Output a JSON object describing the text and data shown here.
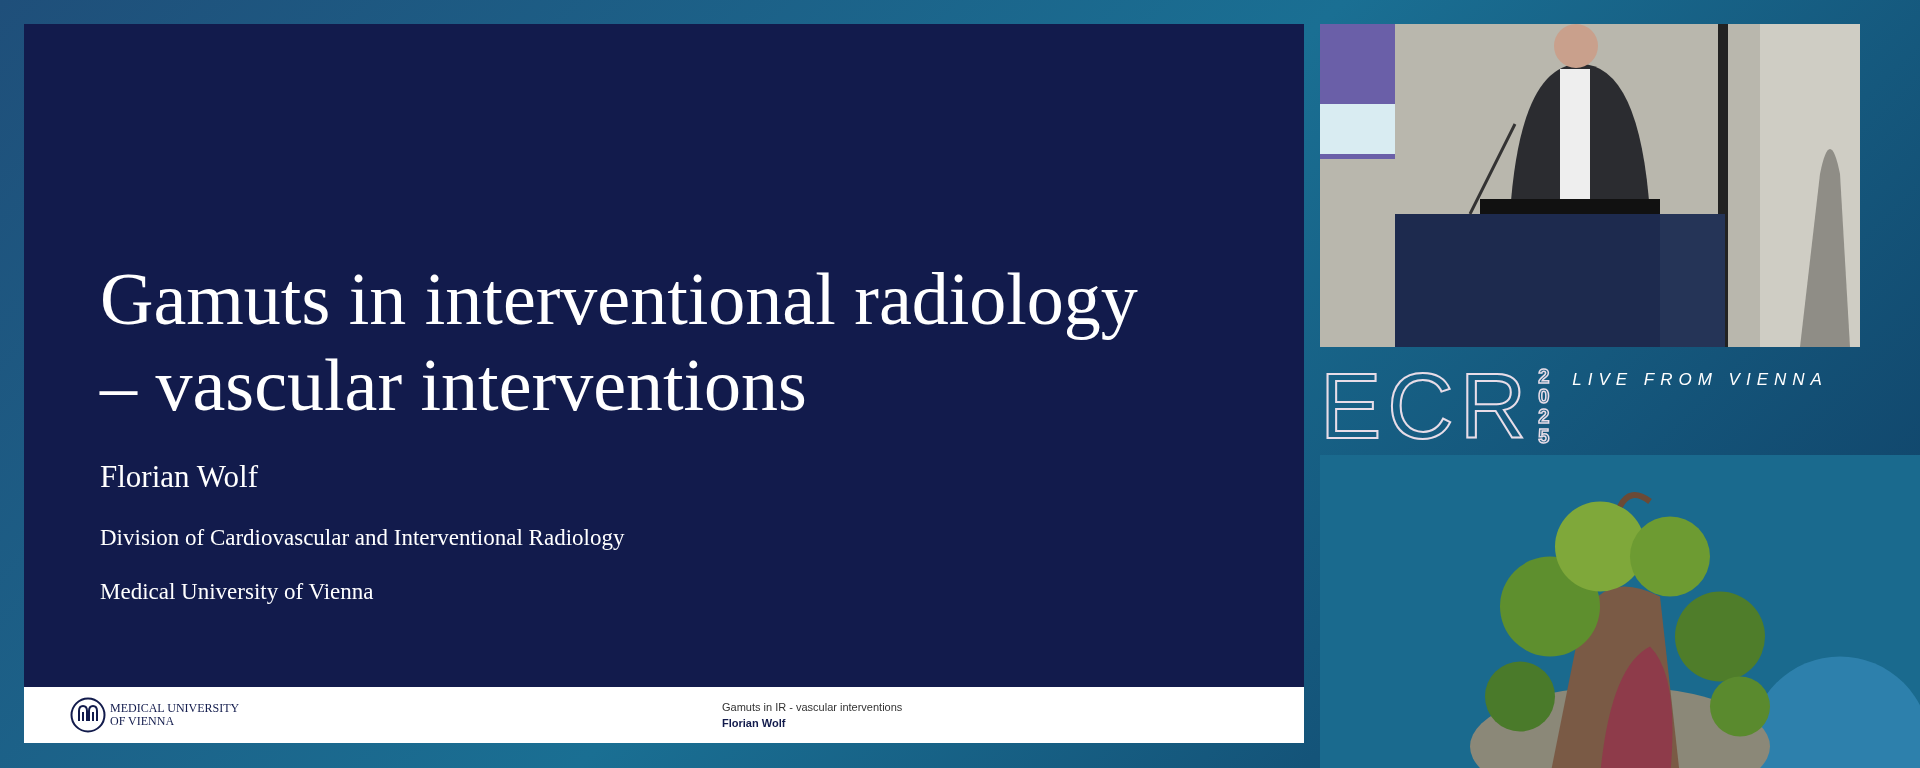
{
  "slide": {
    "title_lines": [
      "Gamuts in interventional radiology",
      "– vascular interventions"
    ],
    "presenter": "Florian Wolf",
    "affiliations": [
      "Division of Cardiovascular and Interventional Radiology",
      "Medical University of Vienna"
    ],
    "footer": {
      "logo_lines": [
        "MEDICAL UNIVERSITY",
        "OF VIENNA"
      ],
      "talk": "Gamuts in IR - vascular interventions",
      "author": "Florian Wolf"
    }
  },
  "branding": {
    "logo": "ECR",
    "year": "2025",
    "tagline": "LIVE FROM VIENNA"
  }
}
